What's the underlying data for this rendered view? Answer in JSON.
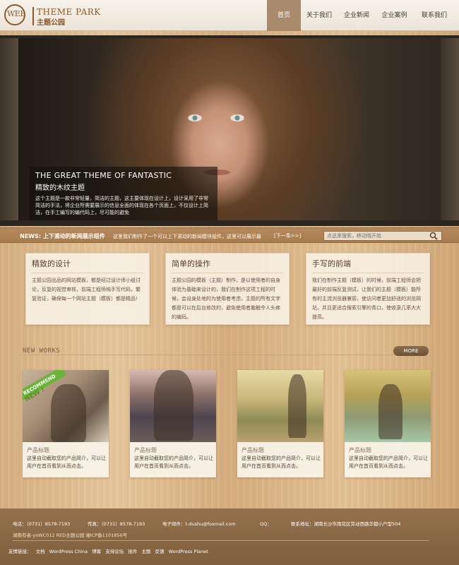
{
  "header": {
    "logo_web": "WEB",
    "logo_title": "THEME PARK",
    "logo_sub": "主题公园",
    "nav": [
      "首页",
      "关于我们",
      "企业新闻",
      "企业案例",
      "联系我们"
    ]
  },
  "banner": {
    "title": "THE GREAT THEME OF FANTASTIC",
    "subtitle": "精致的木纹主题",
    "text": "这个主题是一款非常轻量，简洁的主题，这主要体现在设计上，设计采用了非常简洁的手法，将企业所需要展示的信息全面的体现在各个页面上，不仅设计上简洁，在手工编写的编代码上，尽可能的避免"
  },
  "newsbar": {
    "label": "NEWS: 上下滚动的新闻展示组件",
    "text": "这里我们制作了一个可以上下滚动的新闻模块组件，这里可以展示最",
    "prev": "[下一条>>]",
    "search_placeholder": "点这里搜索，移动哦开始"
  },
  "features": [
    {
      "title": "精致的设计",
      "text": "主题公园出品的网站模板，都是经过设计师小组讨论，反复的视觉审核，前端工程师纯手写代码，繁复验证，确保每一个网站主题（模板）都是精品!"
    },
    {
      "title": "简单的操作",
      "text": "主题公园的模板（主题）制作，是以使用者的自身体验为基础来设计的，我们在制作这项工程的时候，会设身处地的为使用者考虑，主题的所有文字都是可以在后台修改的，避免使用者搬触令人头疼的编码。"
    },
    {
      "title": "手写的前端",
      "text": "我们在制作主题（模板）的时候，前端工程师会把最好的前端反复测试，让我们的主题（模板）能所有的主流浏览器兼容，使访问者更加舒适的浏览网站，并且更适合搜索引擎的青口，使收录几率大大提高。"
    }
  ],
  "works": {
    "title": "NEW WORKS",
    "more": "MORE",
    "ribbon": "RECOMMEND",
    "ribbon_new": "NEW !",
    "items": [
      {
        "name": "产品标题",
        "desc": "这里自动截取您的产品简介，可以让用户在首页看到从而点击。"
      },
      {
        "name": "产品标题",
        "desc": "这里自动截取您的产品简介，可以让用户在首页看到从而点击。"
      },
      {
        "name": "产品标题",
        "desc": "这里自动截取您的产品简介，可以让用户在首页看到从而点击。"
      },
      {
        "name": "产品标题",
        "desc": "这里自动截取您的产品简介，可以让用户在首页看到从而点击。"
      }
    ]
  },
  "footer": {
    "phone": "电话：（0731）8578-7193",
    "fax": "传真：（0731）8578-7193",
    "email": "电子邮件：t-dushu@foxmail.com",
    "qq": "QQ：",
    "address": "联系地址：湖南长沙市雨花区劳动西路华都小户型504",
    "copyright": "湖南有者-yoWC012 RED主题公园    湘ICP备1101856号",
    "links_label": "友情链接：",
    "links": [
      "文档",
      "WordPress China",
      "博客",
      "支持论坛",
      "插件",
      "主题",
      "反馈",
      "WordPress Planet"
    ]
  }
}
